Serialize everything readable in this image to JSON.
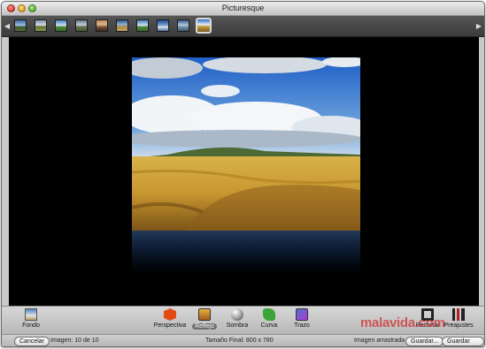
{
  "window": {
    "title": "Picturesque"
  },
  "thumbnails": {
    "count": 10,
    "selected_index": 10,
    "prev_icon": "chevron-left-icon",
    "next_icon": "chevron-right-icon"
  },
  "toolbar": {
    "fondo": "Fondo",
    "perspectiva": "Perspectiva",
    "reflejo": "Reflejo",
    "sombra": "Sombra",
    "curva": "Curva",
    "trazo": "Trazo",
    "recortar": "Recortar",
    "preajustes": "Preajustes",
    "active_tool": "reflejo"
  },
  "status": {
    "cancel_label": "Cancelar",
    "image_counter": "Imagen: 10 de 10",
    "final_size": "Tamaño Final: 800 x 780",
    "dragged_image": "Imagen arrastrada 10",
    "save_label": "Guardar...",
    "save_batch_label": "Guardar lote"
  },
  "watermark": "malavida.com",
  "colors": {
    "canvas_background": "#000000",
    "accent_watermark": "#d22828"
  }
}
